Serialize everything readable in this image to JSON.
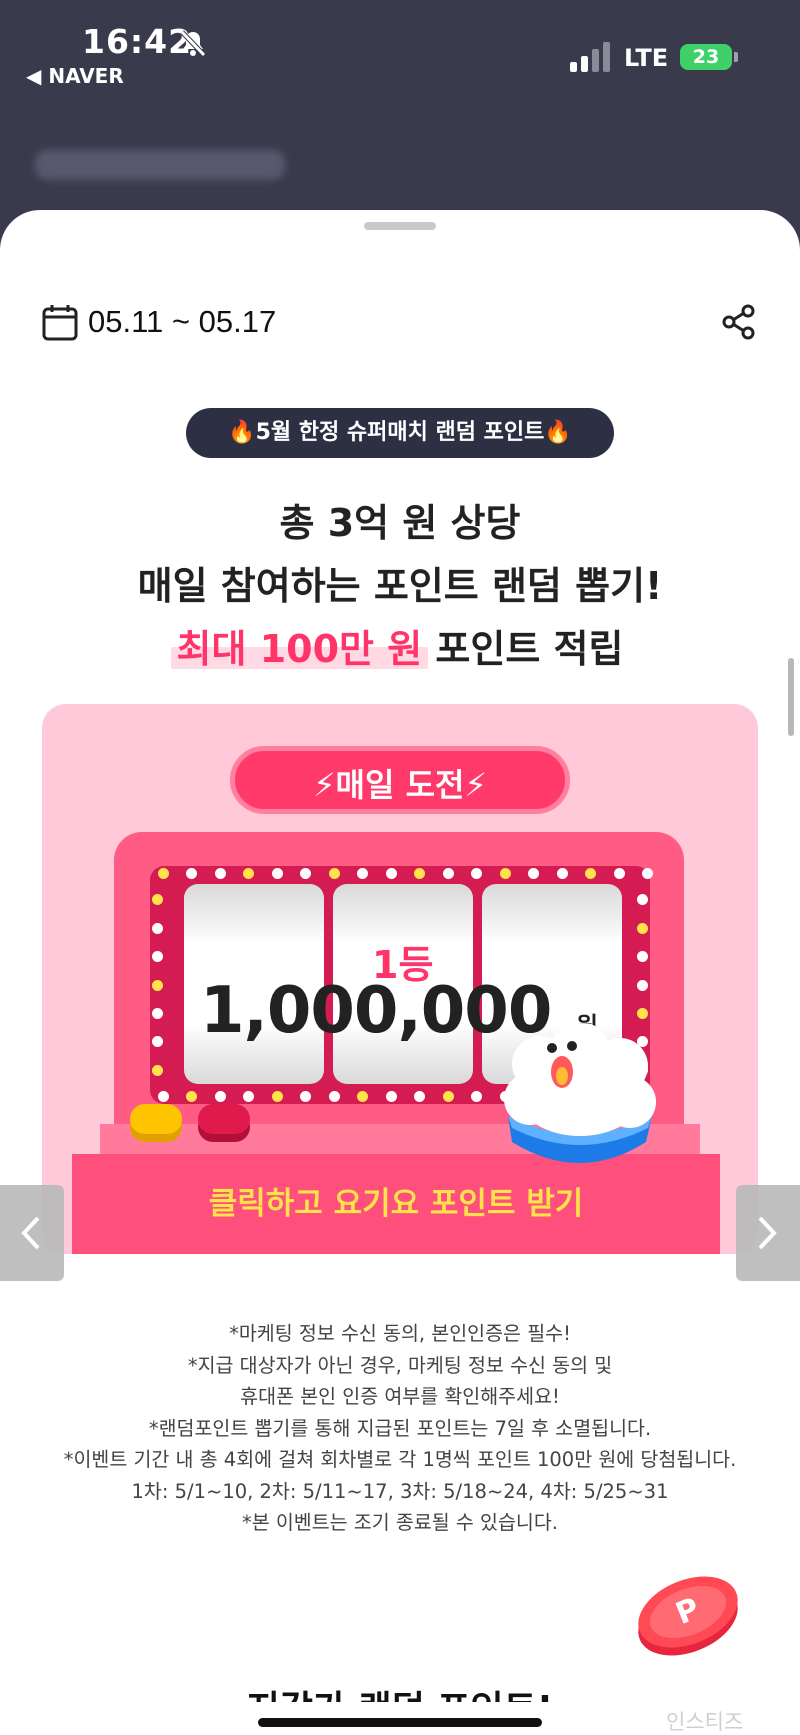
{
  "status_bar": {
    "time": "16:42",
    "back_app": "◀ NAVER",
    "network": "LTE",
    "battery": "23"
  },
  "sheet": {
    "date_range": "05.11 ~ 05.17",
    "badge": "🔥5월 한정 슈퍼매치 랜덤 포인트🔥",
    "headline_1": "총 3억 원 상당",
    "headline_2": "매일 참여하는 포인트 랜덤 뽑기!",
    "headline_3_highlight": "최대 100만 원",
    "headline_3_rest": " 포인트 적립"
  },
  "banner": {
    "daily_label": "⚡매일 도전⚡",
    "rank": "1등",
    "prize": "1,000,000",
    "won": "원",
    "cta": "클릭하고 요기요 포인트 받기"
  },
  "notes": [
    "*마케팅 정보 수신 동의, 본인인증은 필수!",
    "*지급 대상자가 아닌 경우, 마케팅 정보 수신 동의 및",
    "휴대폰 본인 인증 여부를 확인해주세요!",
    "*랜덤포인트 뽑기를 통해 지급된 포인트는 7일 후 소멸됩니다.",
    "*이벤트 기간 내 총 4회에 걸쳐 회차별로 각 1명씩 포인트 100만 원에 당첨됩니다.",
    "1차: 5/1~10, 2차: 5/11~17, 3차: 5/18~24, 4차: 5/25~31",
    "*본 이벤트는 조기 종료될 수 있습니다."
  ],
  "coin_letter": "P",
  "next_section_title": "지갑가 랜덤 포인트!",
  "watermark": "인스티즈",
  "colors": {
    "accent_pink": "#ff3468",
    "dark_badge": "#2d2f43",
    "banner_bg": "#ffc9d9",
    "cta_yellow": "#ffe34a"
  }
}
